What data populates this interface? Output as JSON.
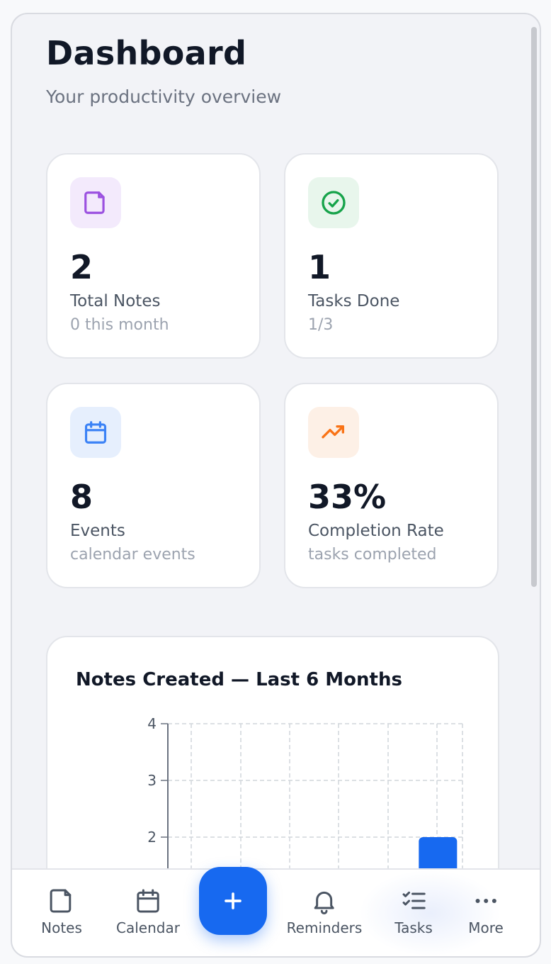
{
  "header": {
    "title": "Dashboard",
    "subtitle": "Your productivity overview"
  },
  "stats": [
    {
      "icon": "note-icon",
      "value": "2",
      "label": "Total Notes",
      "sub": "0 this month",
      "color": "#9b51e0",
      "bg": "#f3eafc"
    },
    {
      "icon": "check-circle-icon",
      "value": "1",
      "label": "Tasks Done",
      "sub": "1/3",
      "color": "#16a34a",
      "bg": "#e8f6ec"
    },
    {
      "icon": "calendar-icon",
      "value": "8",
      "label": "Events",
      "sub": "calendar events",
      "color": "#3b82f6",
      "bg": "#e6effd"
    },
    {
      "icon": "trending-up-icon",
      "value": "33%",
      "label": "Completion Rate",
      "sub": "tasks completed",
      "color": "#f97316",
      "bg": "#fdf0e6"
    }
  ],
  "chart": {
    "title": "Notes Created — Last 6 Months"
  },
  "chart_data": {
    "type": "bar",
    "title": "Notes Created — Last 6 Months",
    "xlabel": "",
    "ylabel": "",
    "ylim": [
      0,
      4
    ],
    "yticks": [
      "4",
      "3",
      "2"
    ],
    "values": [
      0,
      0,
      0,
      0,
      0,
      2
    ],
    "grid": true,
    "bar_color": "#1769f0"
  },
  "nav": {
    "items": [
      {
        "label": "Notes",
        "icon": "note-icon"
      },
      {
        "label": "Calendar",
        "icon": "calendar-icon"
      },
      {
        "label": "Reminders",
        "icon": "bell-icon"
      },
      {
        "label": "Tasks",
        "icon": "checklist-icon"
      },
      {
        "label": "More",
        "icon": "more-icon"
      }
    ],
    "fab_icon": "plus-icon",
    "accent": "#1769f0"
  }
}
